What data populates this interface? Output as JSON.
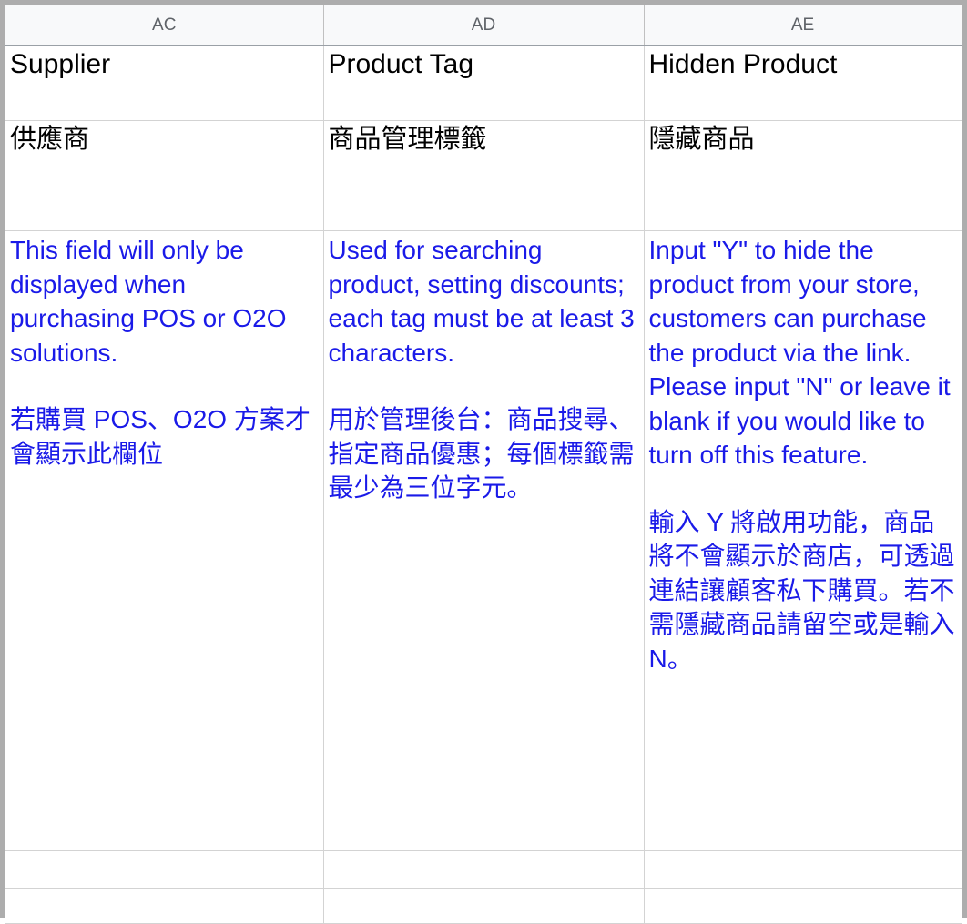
{
  "app": {
    "type": "spreadsheet",
    "accent_blue": "#1a1ae8",
    "header_bg": "#f8f9fa",
    "header_text_color": "#5f6368",
    "gridline_color": "#d3d3d3",
    "frozen_edge_color": "#adadad"
  },
  "columns": [
    {
      "letter": "AC"
    },
    {
      "letter": "AD"
    },
    {
      "letter": "AE"
    }
  ],
  "rows": {
    "field_names_en": [
      "Supplier",
      "Product Tag",
      "Hidden Product"
    ],
    "field_names_zh": [
      "供應商",
      "商品管理標籤",
      "隱藏商品"
    ],
    "descriptions": [
      {
        "en": "This field will only be displayed when purchasing POS or O2O solutions.",
        "zh": "若購買 POS、O2O 方案才會顯示此欄位"
      },
      {
        "en": "Used for searching product, setting discounts; each tag must be at least 3 characters.",
        "zh": "用於管理後台：商品搜尋、指定商品優惠；每個標籤需最少為三位字元。"
      },
      {
        "en": "Input \"Y\" to hide the product from your store, customers can purchase the product via the link. Please input \"N\" or leave it blank if you would like to turn off this feature.",
        "zh": "輸入 Y 將啟用功能，商品將不會顯示於商店，可透過連結讓顧客私下購買。若不需隱藏商品請留空或是輸入 N。"
      }
    ],
    "blank_row_1": [
      "",
      "",
      ""
    ],
    "blank_row_2": [
      "",
      "",
      ""
    ]
  }
}
